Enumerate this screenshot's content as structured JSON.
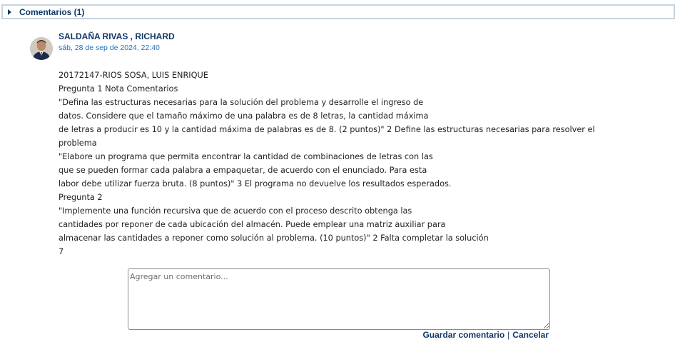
{
  "comments_section": {
    "title": "Comentarios (1)"
  },
  "comment": {
    "author": "SALDAÑA RIVAS , RICHARD",
    "date": "sáb, 28 de sep de 2024, 22:40",
    "lines": [
      "20172147-RIOS SOSA, LUIS ENRIQUE",
      "Pregunta 1 Nota Comentarios",
      "\"Defina las estructuras necesarias para la solución del problema y desarrolle el ingreso de",
      "datos. Considere que el tamaño máximo de una palabra es de 8 letras, la cantidad máxima",
      "de letras a producir es 10 y la cantidad máxima de palabras es de 8. (2 puntos)\" 2 Define las estructuras necesarias para resolver el",
      "problema",
      "\"Elabore un programa que permita encontrar la cantidad de combinaciones de letras con las",
      "que se pueden formar cada palabra a empaquetar, de acuerdo con el enunciado. Para esta",
      "labor debe utilizar fuerza bruta. (8 puntos)\" 3 El programa no devuelve los resultados esperados.",
      "Pregunta 2",
      "\"Implemente una función recursiva que de acuerdo con el proceso descrito obtenga las",
      "cantidades por reponer de cada ubicación del almacén. Puede emplear una matriz auxiliar para",
      "almacenar las cantidades a reponer como solución al problema. (10 puntos)\" 2 Falta completar la solución",
      "7"
    ]
  },
  "new_comment": {
    "placeholder": "Agregar un comentario...",
    "save_label": "Guardar comentario",
    "separator": "|",
    "cancel_label": "Cancelar"
  }
}
